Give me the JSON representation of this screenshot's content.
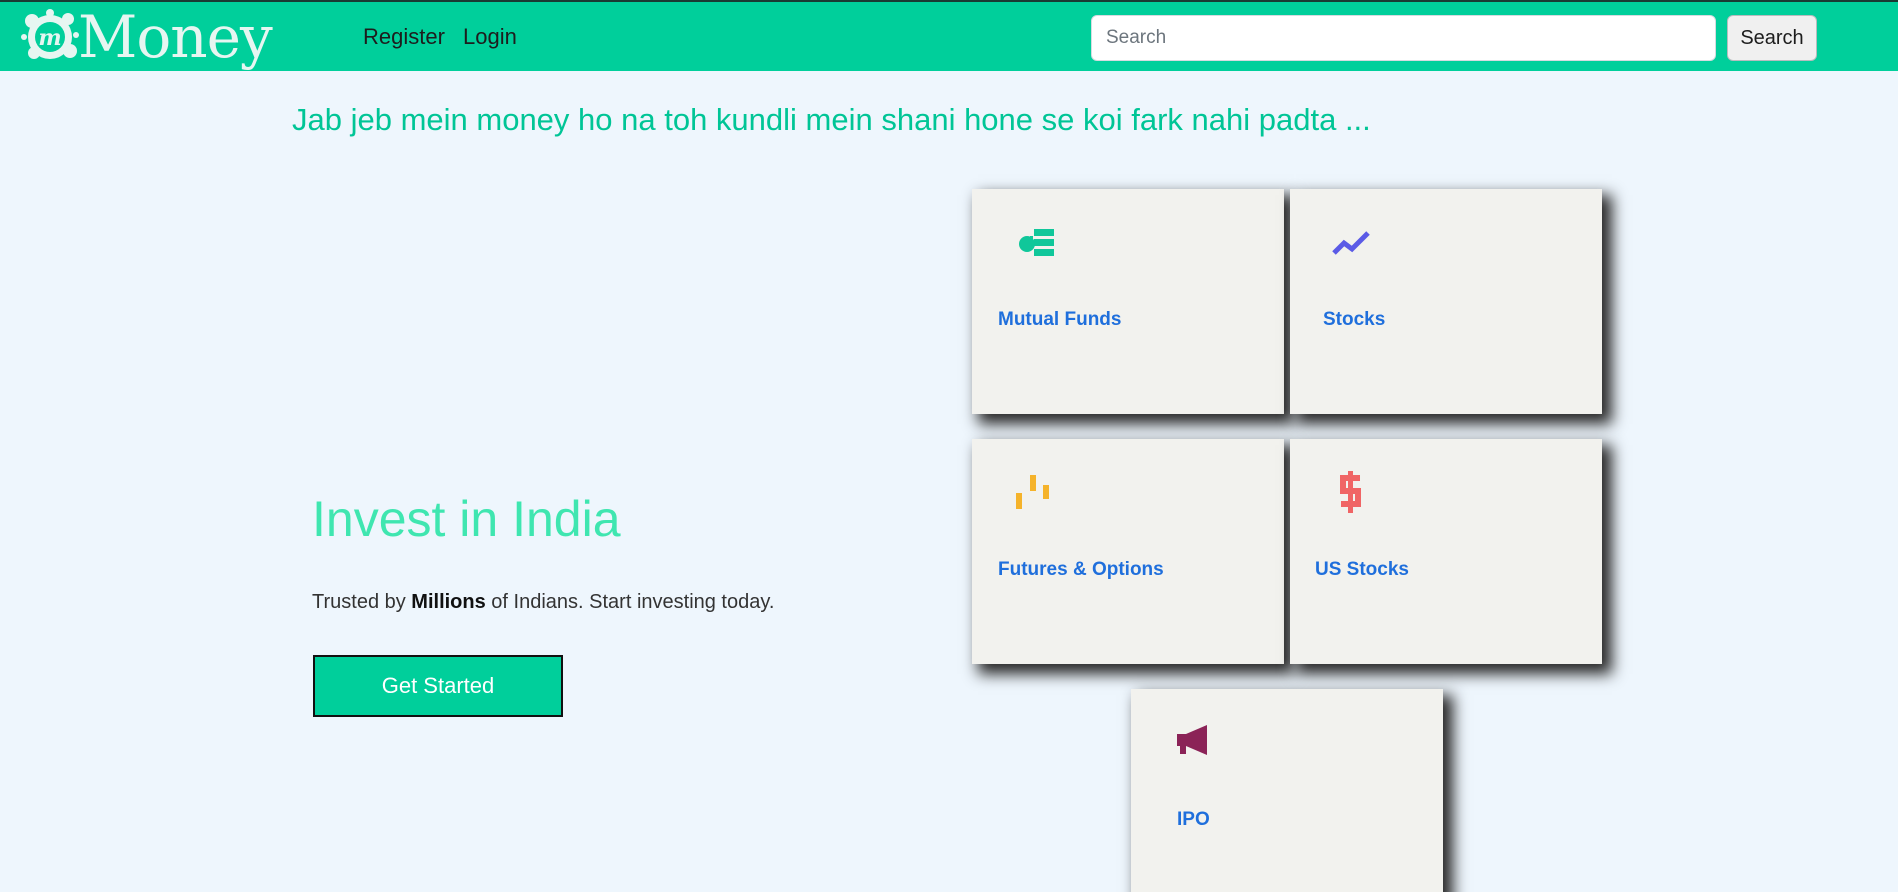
{
  "brand": {
    "name": "Money",
    "badge_letter": "m"
  },
  "nav": {
    "register": "Register",
    "login": "Login"
  },
  "search": {
    "placeholder": "Search",
    "value": "",
    "button": "Search"
  },
  "tagline": "Jab jeb mein money ho na toh kundli mein shani hone se koi fark nahi padta ...",
  "hero": {
    "title": "Invest in India",
    "subtitle_pre": "Trusted by ",
    "subtitle_bold": "Millions",
    "subtitle_post": " of Indians. Start investing today.",
    "cta": "Get Started"
  },
  "cards": [
    {
      "label": "Mutual Funds",
      "icon": "mutual-funds-icon",
      "color": "#10c79a"
    },
    {
      "label": "Stocks",
      "icon": "trend-line-icon",
      "color": "#5b5be6"
    },
    {
      "label": "Futures & Options",
      "icon": "candlestick-icon",
      "color": "#f5b32a"
    },
    {
      "label": "US Stocks",
      "icon": "dollar-icon",
      "color": "#f06565"
    },
    {
      "label": "IPO",
      "icon": "megaphone-icon",
      "color": "#8b2357"
    }
  ],
  "colors": {
    "navbar": "#00cf9b",
    "page_bg": "#eef6fd",
    "tagline": "#00c596",
    "hero_title": "#3fe6b0",
    "card_label": "#1f6fdc",
    "card_bg": "#f2f2ee"
  }
}
